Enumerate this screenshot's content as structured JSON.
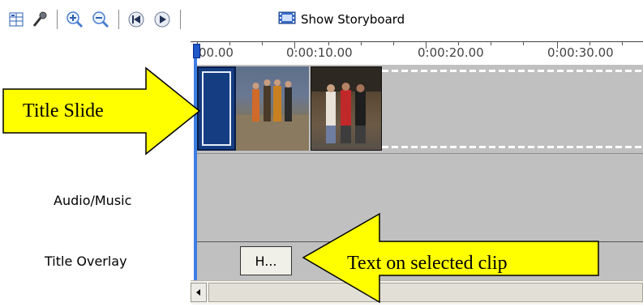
{
  "toolbar": {
    "buttons": [
      {
        "icon": "timeline-layout-icon"
      },
      {
        "icon": "narrate-microphone-icon"
      },
      {
        "icon": "zoom-in-icon"
      },
      {
        "icon": "zoom-out-icon"
      },
      {
        "icon": "rewind-icon"
      },
      {
        "icon": "play-icon"
      }
    ],
    "storyboard_label": "Show Storyboard"
  },
  "ruler": {
    "labels": [
      "00.00",
      "0:00:10.00",
      "0:00:20.00",
      "0:00:30.00"
    ]
  },
  "tracks": {
    "audio_label": "Audio/Music",
    "overlay_label": "Title Overlay"
  },
  "overlay_clip": {
    "label": "H..."
  },
  "callouts": {
    "left": "Title Slide",
    "right": "Text on selected clip"
  },
  "colors": {
    "track_bg": "#c0c0c0",
    "playhead": "#3f7ee2",
    "callout_fill": "#ffff00",
    "title_clip": "#153d82"
  }
}
